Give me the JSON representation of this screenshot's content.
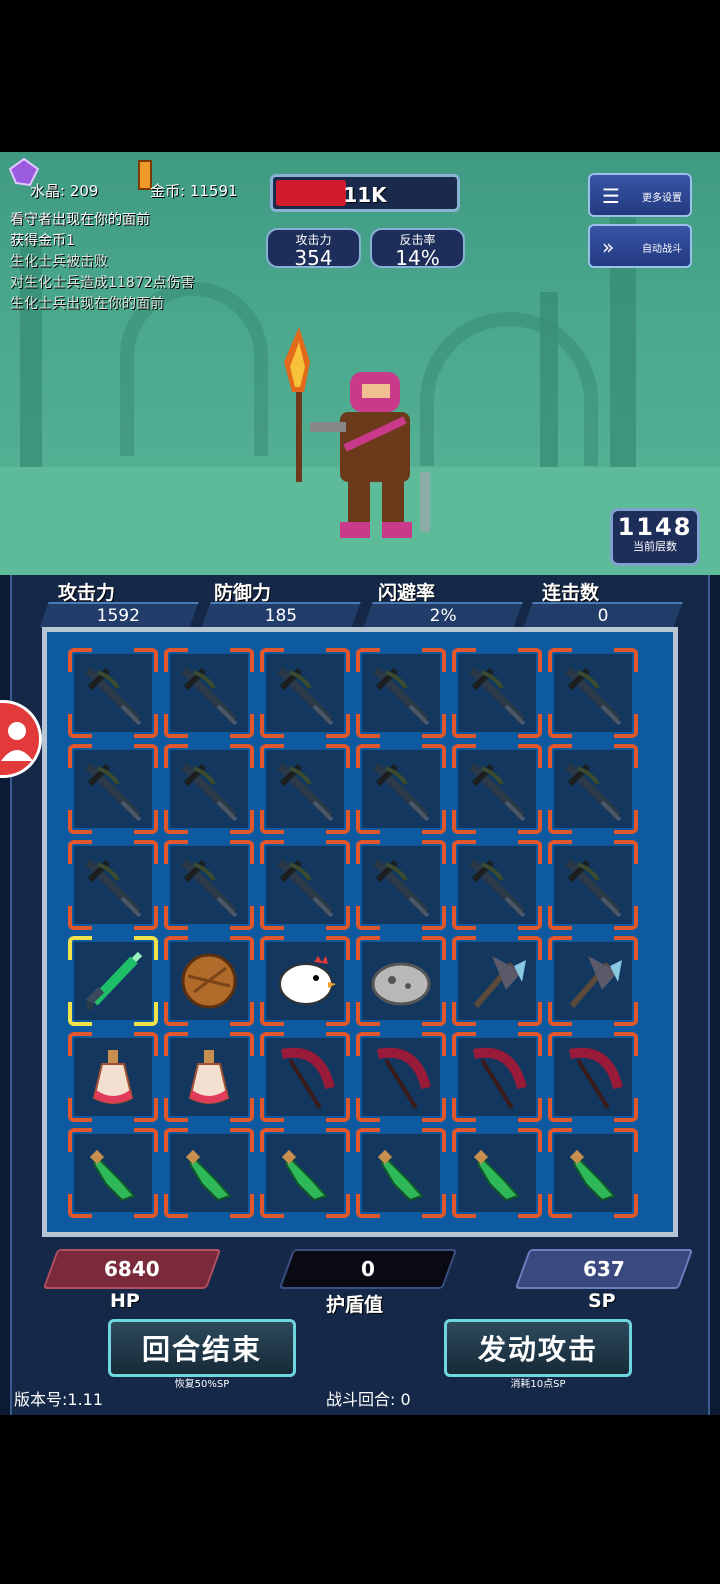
{
  "top": {
    "crystal_label": "水晶: 209",
    "gold_label": "金币: 11591",
    "enemy_hp": "11K",
    "enemy_hp_fraction": 0.38,
    "attack_label": "攻击力",
    "attack_value": "354",
    "counter_label": "反击率",
    "counter_value": "14%",
    "more_settings": "更多设置",
    "auto_battle": "自动战斗",
    "floor_number": "1148",
    "floor_label": "当前层数"
  },
  "log": [
    "看守者出现在你的面前",
    "获得金币1",
    "生化士兵被击败",
    "对生化士兵造成11872点伤害",
    "生化士兵出现在你的面前"
  ],
  "stats": [
    {
      "label": "攻击力",
      "value": "1592"
    },
    {
      "label": "防御力",
      "value": "185"
    },
    {
      "label": "闪避率",
      "value": "2%"
    },
    {
      "label": "连击数",
      "value": "0"
    }
  ],
  "grid": {
    "rows": [
      [
        "crossbow-icon",
        "crossbow-icon",
        "crossbow-icon",
        "crossbow-icon",
        "crossbow-icon",
        "crossbow-icon"
      ],
      [
        "crossbow-icon",
        "crossbow-icon",
        "crossbow-icon",
        "crossbow-icon",
        "crossbow-icon",
        "crossbow-icon"
      ],
      [
        "crossbow-icon",
        "crossbow-icon",
        "crossbow-icon",
        "crossbow-icon",
        "crossbow-icon",
        "crossbow-icon"
      ],
      [
        "green-sword-icon",
        "wooden-shield-icon",
        "chicken-icon",
        "stone-icon",
        "battle-axe-icon",
        "battle-axe-icon"
      ],
      [
        "potion-icon",
        "potion-icon",
        "scythe-icon",
        "scythe-icon",
        "scythe-icon",
        "scythe-icon"
      ],
      [
        "green-crystal-icon",
        "green-crystal-icon",
        "green-crystal-icon",
        "green-crystal-icon",
        "green-crystal-icon",
        "green-crystal-icon"
      ]
    ],
    "selected": [
      3,
      0
    ]
  },
  "player": {
    "hp_value": "6840",
    "hp_label": "HP",
    "shield_value": "0",
    "shield_label": "护盾值",
    "sp_value": "637",
    "sp_label": "SP"
  },
  "actions": {
    "end_turn": "回合结束",
    "end_turn_sub": "恢复50%SP",
    "attack": "发动攻击",
    "attack_sub": "消耗10点SP"
  },
  "footer": {
    "version": "版本号:1.11",
    "round": "战斗回合: 0"
  },
  "colors": {
    "scene_bg": "#4aa88d",
    "panel_bg": "#152848",
    "grid_bg": "#0e5aa0",
    "corner": "#e2582c",
    "selected_corner": "#f1e24a",
    "hp_fill": "#d01c2c"
  }
}
